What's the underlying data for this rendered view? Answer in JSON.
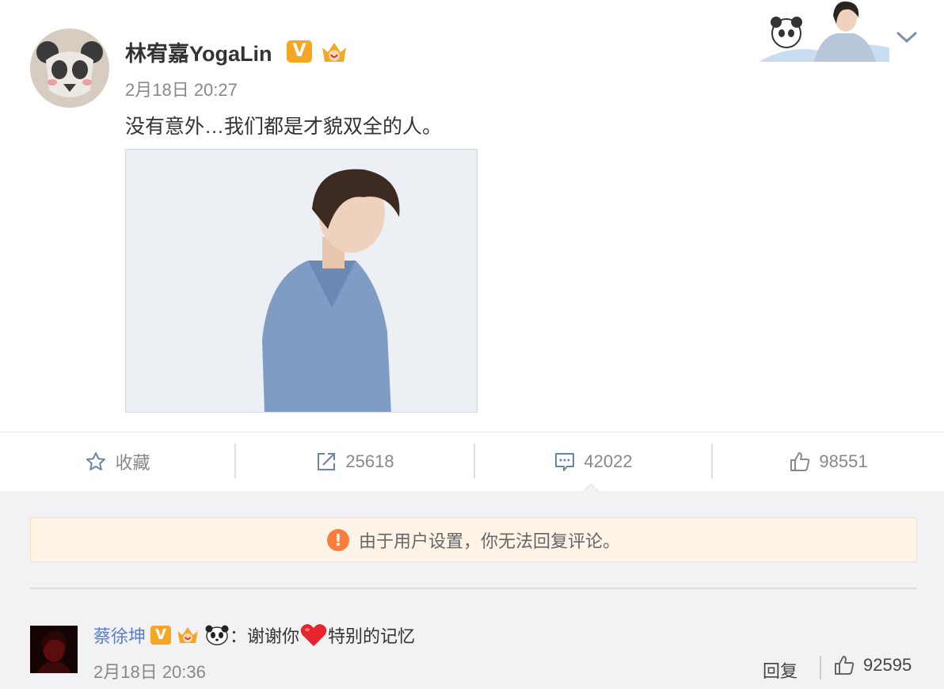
{
  "post": {
    "user_name": "林宥嘉YogaLin",
    "verified_badge": "V",
    "time": "2月18日 20:27",
    "text": "没有意外…我们都是才貌双全的人。"
  },
  "actions": {
    "favorite_label": "收藏",
    "repost_count": "25618",
    "comment_count": "42022",
    "like_count": "98551"
  },
  "notice": {
    "icon": "!",
    "text": "由于用户设置，你无法回复评论。"
  },
  "comment": {
    "user_name": "蔡徐坤",
    "verified_badge": "V",
    "separator": "：",
    "text_before": "谢谢你",
    "text_after": " 特别的记忆",
    "time": "2月18日 20:36",
    "reply_label": "回复",
    "like_count": "92595"
  },
  "colors": {
    "accent_orange": "#fa7d3c",
    "verified": "#f5a623",
    "link_blue": "#5a7fc6",
    "heart_red": "#e8242d"
  },
  "icons": [
    "panda-avatar-icon",
    "verified-badge-icon",
    "crown-icon",
    "chevron-down-icon",
    "star-icon",
    "repost-icon",
    "comment-icon",
    "like-icon",
    "warning-icon",
    "panda-emoji-icon",
    "heart-emoji-icon"
  ]
}
